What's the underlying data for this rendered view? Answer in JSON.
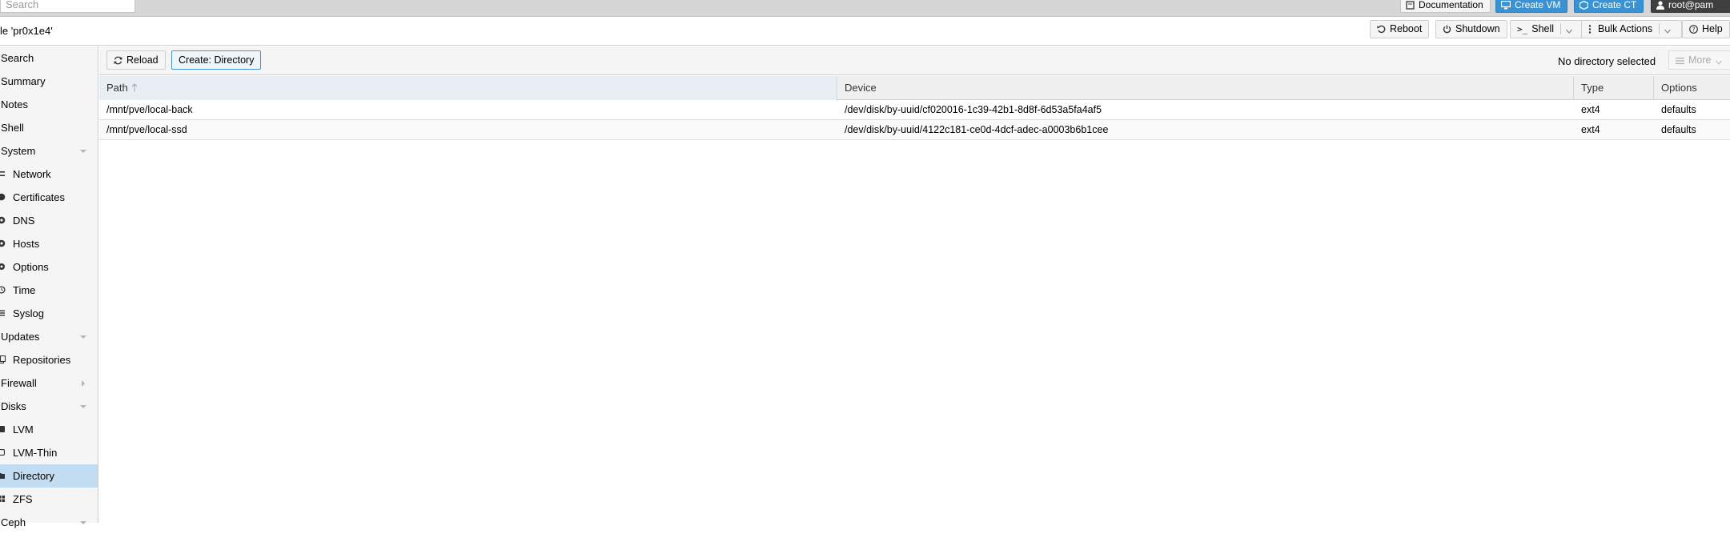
{
  "topbar": {
    "search_placeholder": "Search",
    "documentation_label": "Documentation",
    "create_vm_label": "Create VM",
    "create_ct_label": "Create CT",
    "user_label": "root@pam"
  },
  "titlebar": {
    "title": "le 'pr0x1e4'",
    "reboot_label": "Reboot",
    "shutdown_label": "Shutdown",
    "shell_label": "Shell",
    "bulk_actions_label": "Bulk Actions",
    "help_label": "Help"
  },
  "sidebar": {
    "items": [
      {
        "label": "Search"
      },
      {
        "label": "Summary"
      },
      {
        "label": "Notes"
      },
      {
        "label": "Shell"
      },
      {
        "label": "System"
      },
      {
        "label": "Network"
      },
      {
        "label": "Certificates"
      },
      {
        "label": "DNS"
      },
      {
        "label": "Hosts"
      },
      {
        "label": "Options"
      },
      {
        "label": "Time"
      },
      {
        "label": "Syslog"
      },
      {
        "label": "Updates"
      },
      {
        "label": "Repositories"
      },
      {
        "label": "Firewall"
      },
      {
        "label": "Disks"
      },
      {
        "label": "LVM"
      },
      {
        "label": "LVM-Thin"
      },
      {
        "label": "Directory"
      },
      {
        "label": "ZFS"
      },
      {
        "label": "Ceph"
      }
    ]
  },
  "content": {
    "reload_label": "Reload",
    "create_directory_label": "Create: Directory",
    "status_text": "No directory selected",
    "more_label": "More",
    "columns": {
      "path": "Path",
      "device": "Device",
      "type": "Type",
      "options": "Options"
    },
    "rows": [
      {
        "path": "/mnt/pve/local-back",
        "device": "/dev/disk/by-uuid/cf020016-1c39-42b1-8d8f-6d53a5fa4af5",
        "type": "ext4",
        "options": "defaults"
      },
      {
        "path": "/mnt/pve/local-ssd",
        "device": "/dev/disk/by-uuid/4122c181-ce0d-4dcf-adec-a0003b6b1cee",
        "type": "ext4",
        "options": "defaults"
      }
    ]
  }
}
